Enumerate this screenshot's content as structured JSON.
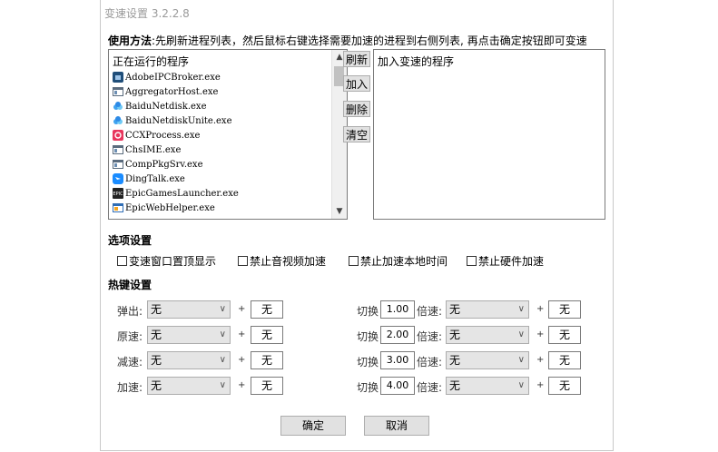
{
  "window": {
    "title": "变速设置 3.2.2.8"
  },
  "usage": {
    "label": "使用方法",
    "text": ":先刷新进程列表，然后鼠标右键选择需要加速的进程到右侧列表, 再点击确定按钮即可变速"
  },
  "running_list": {
    "header": "正在运行的程序",
    "items": [
      {
        "name": "AdobeIPCBroker.exe",
        "icon": "adobe-icon"
      },
      {
        "name": "AggregatorHost.exe",
        "icon": "window-icon"
      },
      {
        "name": "BaiduNetdisk.exe",
        "icon": "baidu-netdisk-icon"
      },
      {
        "name": "BaiduNetdiskUnite.exe",
        "icon": "baidu-netdisk-icon"
      },
      {
        "name": "CCXProcess.exe",
        "icon": "creative-cloud-icon"
      },
      {
        "name": "ChsIME.exe",
        "icon": "window-icon"
      },
      {
        "name": "CompPkgSrv.exe",
        "icon": "window-icon"
      },
      {
        "name": "DingTalk.exe",
        "icon": "dingtalk-icon"
      },
      {
        "name": "EpicGamesLauncher.exe",
        "icon": "epic-icon"
      },
      {
        "name": "EpicWebHelper.exe",
        "icon": "window-blue-icon"
      }
    ]
  },
  "side_buttons": {
    "refresh": "刷新",
    "add": "加入",
    "remove": "删除",
    "clear": "清空"
  },
  "accelerated_list": {
    "header": "加入变速的程序"
  },
  "options": {
    "title": "选项设置",
    "items": [
      "变速窗口置顶显示",
      "禁止音视频加速",
      "禁止加速本地时间",
      "禁止硬件加速"
    ]
  },
  "hotkeys": {
    "title": "热键设置",
    "left": [
      {
        "label": "弹出:",
        "modifier": "无",
        "key": "无"
      },
      {
        "label": "原速:",
        "modifier": "无",
        "key": "无"
      },
      {
        "label": "减速:",
        "modifier": "无",
        "key": "无"
      },
      {
        "label": "加速:",
        "modifier": "无",
        "key": "无"
      }
    ],
    "right": [
      {
        "switch": "切换",
        "speed": "1.00",
        "speed_label": "倍速:",
        "modifier": "无",
        "key": "无"
      },
      {
        "switch": "切换",
        "speed": "2.00",
        "speed_label": "倍速:",
        "modifier": "无",
        "key": "无"
      },
      {
        "switch": "切换",
        "speed": "3.00",
        "speed_label": "倍速:",
        "modifier": "无",
        "key": "无"
      },
      {
        "switch": "切换",
        "speed": "4.00",
        "speed_label": "倍速:",
        "modifier": "无",
        "key": "无"
      }
    ],
    "plus": "+"
  },
  "footer": {
    "ok": "确定",
    "cancel": "取消"
  }
}
